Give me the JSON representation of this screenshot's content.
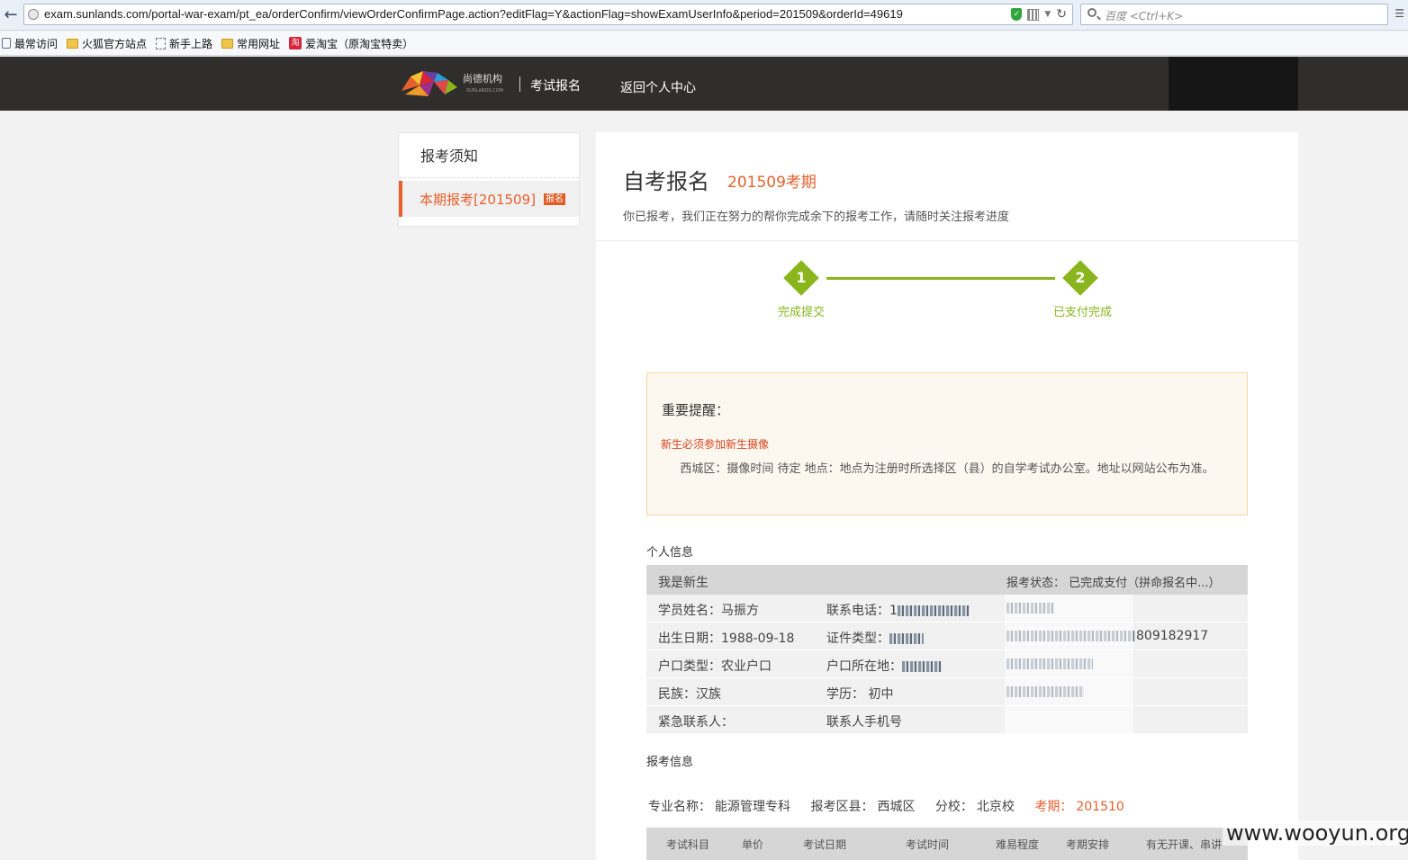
{
  "browser": {
    "url": "exam.sunlands.com/portal-war-exam/pt_ea/orderConfirm/viewOrderConfirmPage.action?editFlag=Y&actionFlag=showExamUserInfo&period=201509&orderId=49619",
    "search_placeholder": "百度 <Ctrl+K>",
    "bookmarks": [
      "最常访问",
      "火狐官方站点",
      "新手上路",
      "常用网址",
      "爱淘宝（原淘宝特卖）"
    ],
    "bookmark_icons": [
      "gear-icon",
      "folder-icon",
      "page-icon",
      "folder-icon",
      "taobao-icon"
    ],
    "tao_glyph": "淘"
  },
  "header": {
    "logo_text": "尚德机构",
    "logo_sub": "SUNLANDS.COM",
    "title": "考试报名",
    "back_link": "返回个人中心"
  },
  "sidebar": {
    "items": [
      {
        "label": "报考须知"
      },
      {
        "label": "本期报考[201509]",
        "badge": "报名",
        "active": true
      }
    ]
  },
  "main": {
    "title": "自考报名",
    "period": "201509考期",
    "subtitle": "你已报考，我们正在努力的帮你完成余下的报考工作，请随时关注报考进度"
  },
  "steps": [
    {
      "num": "1",
      "label": "完成提交"
    },
    {
      "num": "2",
      "label": "已支付完成"
    }
  ],
  "notice": {
    "title": "重要提醒：",
    "red": "新生必须参加新生摄像",
    "body": "西城区：摄像时间 待定 地点：地点为注册时所选择区（县）的自学考试办公室。地址以网站公布为准。"
  },
  "personal": {
    "section": "个人信息",
    "head_left": "我是新生",
    "head_right": "报考状态： 已完成支付（拼命报名中...）",
    "rows": [
      {
        "c1": "学员姓名：马振方",
        "c2": "联系电话：1",
        "c3": ""
      },
      {
        "c1": "出生日期：1988-09-18",
        "c2": "证件类型：",
        "c3": "809182917"
      },
      {
        "c1": "户口类型：农业户口",
        "c2": "户口所在地：",
        "c3": ""
      },
      {
        "c1": "民族：汉族",
        "c2": "学历： 初中",
        "c3": ""
      },
      {
        "c1": "紧急联系人：",
        "c2": "联系人手机号",
        "c3": ""
      }
    ]
  },
  "registration": {
    "section": "报考信息",
    "major_label": "专业名称：",
    "major": "能源管理专科",
    "area_label": "报考区县：",
    "area": "西城区",
    "branch_label": "分校：",
    "branch": "北京校",
    "period_label": "考期：",
    "period": "201510",
    "columns": [
      "考试科目",
      "单价",
      "考试日期",
      "考试时间",
      "难易程度",
      "考期安排",
      "有无开课、串讲"
    ]
  },
  "watermark": "www.wooyun.org",
  "colors": {
    "accent": "#e8602c",
    "step_green": "#8ab51d",
    "header_bg": "#2f2e2c"
  }
}
